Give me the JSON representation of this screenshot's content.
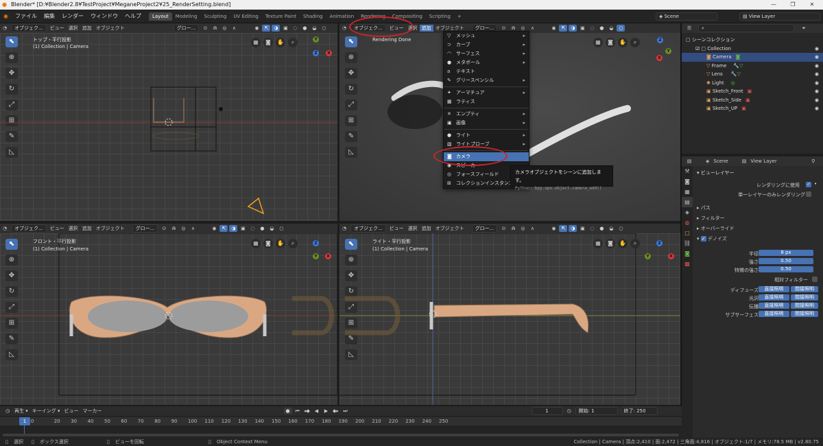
{
  "window": {
    "title": "Blender* [D:¥Blender2.8¥TestProject¥MeganeProject2¥25_RenderSetting.blend]",
    "buttons": [
      "—",
      "❐",
      "✕"
    ]
  },
  "menubar": {
    "items": [
      "ファイル",
      "編集",
      "レンダー",
      "ウィンドウ",
      "ヘルプ"
    ]
  },
  "workspaces": [
    "Layout",
    "Modeling",
    "Sculpting",
    "UV Editing",
    "Texture Paint",
    "Shading",
    "Animation",
    "Rendering",
    "Compositing",
    "Scripting"
  ],
  "workspace_add": "+",
  "scene": {
    "name": "Scene",
    "view_layer": "View Layer"
  },
  "viewport_header": {
    "mode": "オブジェク...",
    "view": "ビュー",
    "select": "選択",
    "add": "追加",
    "object": "オブジェクト",
    "global": "グロー...",
    "mode_q4": "オブジェク..."
  },
  "viewports": {
    "top": {
      "view": "トップ・平行投影",
      "collection": "(1) Collection | Camera"
    },
    "persp": {
      "status": "Rendering Done"
    },
    "front": {
      "view": "フロント・平行投影",
      "collection": "(1) Collection | Camera"
    },
    "right": {
      "view": "ライト・平行投影",
      "collection": "(1) Collection | Camera"
    }
  },
  "gizmo": {
    "x": "X",
    "y": "Y",
    "z": "Z"
  },
  "add_menu": {
    "items": [
      {
        "label": "メッシュ",
        "icon": "▽",
        "arrow": "▸"
      },
      {
        "label": "カーブ",
        "icon": "⊃",
        "arrow": "▸"
      },
      {
        "label": "サーフェス",
        "icon": "◠",
        "arrow": "▸"
      },
      {
        "label": "メタボール",
        "icon": "●",
        "arrow": "▸"
      },
      {
        "label": "テキスト",
        "icon": "a",
        "arrow": ""
      },
      {
        "label": "グリースペンシル",
        "icon": "✎",
        "arrow": "▸"
      },
      {
        "label": "アーマチュア",
        "icon": "✦",
        "arrow": "▸"
      },
      {
        "label": "ラティス",
        "icon": "▦",
        "arrow": ""
      },
      {
        "label": "エンプティ",
        "icon": "✕",
        "arrow": "▸"
      },
      {
        "label": "画像",
        "icon": "▣",
        "arrow": "▸"
      },
      {
        "label": "ライト",
        "icon": "●",
        "arrow": "▸"
      },
      {
        "label": "ライトプローブ",
        "icon": "▧",
        "arrow": "▸"
      },
      {
        "label": "カメラ",
        "icon": "◙",
        "arrow": ""
      },
      {
        "label": "スピーカー",
        "icon": "◉",
        "arrow": ""
      },
      {
        "label": "フォースフィールド",
        "icon": "◎",
        "arrow": "▸"
      },
      {
        "label": "コレクションインスタンス",
        "icon": "⊞",
        "arrow": "▸"
      }
    ]
  },
  "tooltip": {
    "text": "カメラオブジェクトをシーンに追加します。",
    "python": "Python: bpy.ops.object.camera_add()"
  },
  "outliner": {
    "root": "シーンコレクション",
    "collection": "Collection",
    "items": [
      "Camera",
      "Frame",
      "Lens",
      "Light",
      "Sketch_Front",
      "Sketch_Side",
      "Sketch_UP"
    ]
  },
  "properties": {
    "scene": "Scene",
    "view_layer": "View Layer",
    "section_view_layer": "ビューレイヤー",
    "use_for_render": "レンダリングに使用",
    "single_layer": "単一レイヤーのみレンダリング",
    "passes": "パス",
    "filter": "フィルター",
    "override": "オーバーライド",
    "denoise": "デノイズ",
    "radius_label": "半径",
    "radius": "8 px",
    "strength_label": "強さ",
    "strength": "0.50",
    "feature_label": "特徴の強さ",
    "feature": "0.50",
    "relative_filter": "相対フィルター",
    "rows": [
      {
        "label": "ディフューズ"
      },
      {
        "label": "光沢"
      },
      {
        "label": "伝播"
      },
      {
        "label": "サブサーフェス"
      }
    ],
    "direct": "直接照明",
    "indirect": "間接照明"
  },
  "timeline": {
    "playback": "再生",
    "keying": "キーイング",
    "view": "ビュー",
    "marker": "マーカー",
    "current": "1",
    "start_label": "開始:",
    "start": "1",
    "end_label": "終了:",
    "end": "250",
    "ruler": [
      "1",
      "10",
      "20",
      "30",
      "40",
      "50",
      "60",
      "70",
      "80",
      "90",
      "100",
      "110",
      "120",
      "130",
      "140",
      "150",
      "160",
      "170",
      "180",
      "190",
      "200",
      "210",
      "220",
      "230",
      "240",
      "250"
    ]
  },
  "statusbar": {
    "select": "選択",
    "box": "ボックス選択",
    "rotate": "ビューを回転",
    "context": "Object Context Menu",
    "info": "Collection | Camera | 頂点:2,410 | 面:2,472 | 三角面:4,816 | オブジェクト:1/7 | メモリ:78.5 MB | v2.80.75"
  }
}
